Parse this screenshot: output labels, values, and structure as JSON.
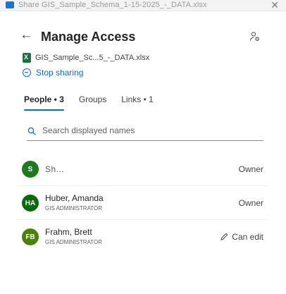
{
  "window": {
    "title": "Share  GIS_Sample_Schema_1-15-2025_-_DATA.xlsx",
    "close_glyph": "✕",
    "app_icon": "share-app-icon"
  },
  "header": {
    "back_glyph": "←",
    "title": "Manage Access",
    "settings_icon": "people-settings-icon"
  },
  "file": {
    "icon": "excel-file-icon",
    "name": "GIS_Sample_Sc...5_-_DATA.xlsx"
  },
  "stop_sharing": {
    "icon": "minus-circle-icon",
    "label": "Stop sharing"
  },
  "tabs": [
    {
      "label": "People • 3",
      "active": true
    },
    {
      "label": "Groups",
      "active": false
    },
    {
      "label": "Links • 1",
      "active": false
    }
  ],
  "search": {
    "placeholder": "Search displayed names",
    "value": "",
    "icon": "search-icon"
  },
  "people": [
    {
      "initials": "S",
      "name": "Sh...",
      "subtitle": "",
      "role": "Owner",
      "avatar_color": "#1e7a1e",
      "editable": false
    },
    {
      "initials": "HA",
      "name": "Huber, Amanda",
      "subtitle": "GIS ADMINISTRATOR",
      "role": "Owner",
      "avatar_color": "#0b6a0b",
      "editable": false
    },
    {
      "initials": "FB",
      "name": "Frahm, Brett",
      "subtitle": "GIS ADMINISTRATOR",
      "role": "Can edit",
      "avatar_color": "#498205",
      "editable": true
    }
  ],
  "colors": {
    "accent": "#0f6cbd",
    "excel_green": "#1d7044"
  }
}
